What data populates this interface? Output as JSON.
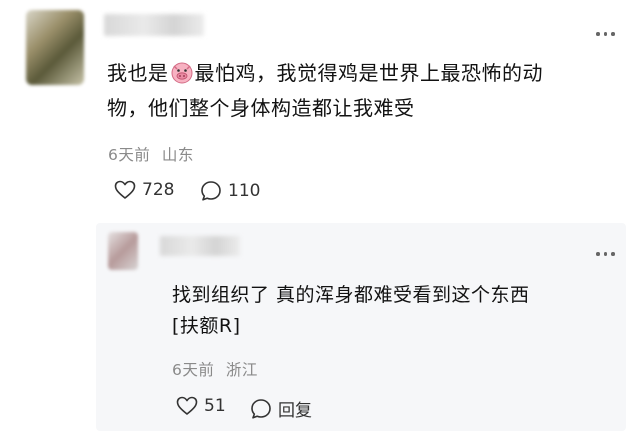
{
  "comment": {
    "text_line1": "我也是",
    "emoji_name": "pig-face-emoji",
    "text_line1_rest": "最怕鸡，我觉得鸡是世界上最恐怖的动",
    "text_line2": "物，他们整个身体构造都让我难受",
    "time": "6天前",
    "location": "山东",
    "likes": "728",
    "replies": "110"
  },
  "reply": {
    "text_line1": "找到组织了 真的浑身都难受看到这个东西",
    "text_line2": "[扶额R]",
    "time": "6天前",
    "location": "浙江",
    "likes": "51",
    "reply_label": "回复"
  },
  "colors": {
    "text": "#121212",
    "meta": "#8a8a8a",
    "icon": "#333333"
  }
}
